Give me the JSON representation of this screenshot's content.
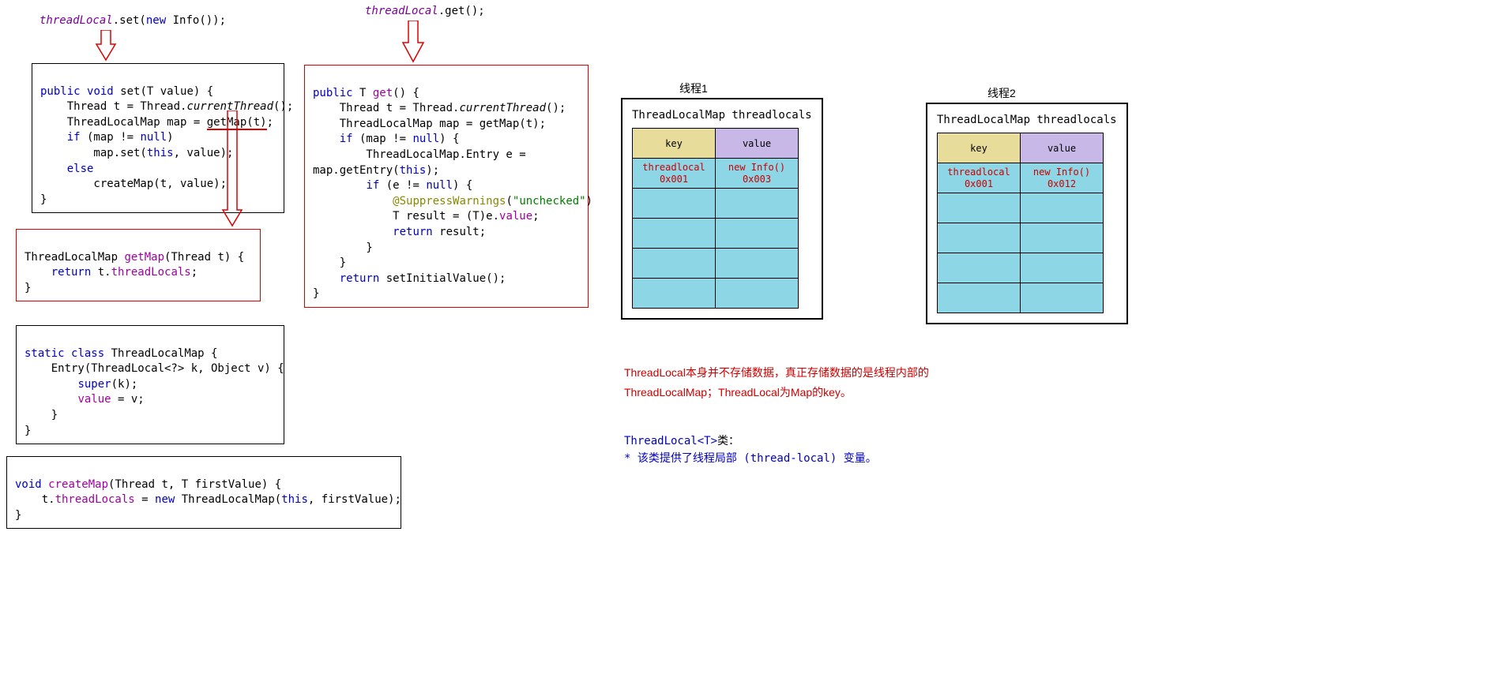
{
  "title_set": {
    "pre": "threadLocal",
    "mid": ".set(",
    "kw": "new",
    "post": " Info());"
  },
  "title_get": {
    "pre": "threadLocal",
    "post": ".get();"
  },
  "code_set": {
    "l1a": "public",
    "l1b": "void",
    "l1c": " set(T value) {",
    "l2a": "    Thread t = Thread.",
    "l2b": "currentThread",
    "l2c": "();",
    "l3a": "    ThreadLocalMap map = ",
    "l3b": "getMap(t)",
    "l3c": ";",
    "l4a": "    ",
    "l4b": "if",
    "l4c": " (map != ",
    "l4d": "null",
    "l4e": ")",
    "l5a": "        map.set(",
    "l5b": "this",
    "l5c": ", value);",
    "l6a": "    ",
    "l6b": "else",
    "l7": "        createMap(t, value);",
    "l8": "}"
  },
  "code_getmap": {
    "l1a": "ThreadLocalMap ",
    "l1b": "getMap",
    "l1c": "(Thread t) {",
    "l2a": "    ",
    "l2b": "return",
    "l2c": " t.",
    "l2d": "threadLocals",
    "l2e": ";",
    "l3": "}"
  },
  "code_tlmap": {
    "l1a": "static",
    "l1b": "class",
    "l1c": " ThreadLocalMap {",
    "l2": "    Entry(ThreadLocal<?> k, Object v) {",
    "l3a": "        ",
    "l3b": "super",
    "l3c": "(k);",
    "l4a": "        ",
    "l4b": "value",
    "l4c": " = v;",
    "l5": "    }",
    "l6": "}"
  },
  "code_create": {
    "l1a": "void",
    "l1b": " ",
    "l1c": "createMap",
    "l1d": "(Thread t, T firstValue) {",
    "l2a": "    t.",
    "l2b": "threadLocals",
    "l2c": " = ",
    "l2d": "new",
    "l2e": " ThreadLocalMap(",
    "l2f": "this",
    "l2g": ", firstValue);",
    "l3": "}"
  },
  "code_get": {
    "l1a": "public",
    "l1b": " T ",
    "l1c": "get",
    "l1d": "() {",
    "l2a": "    Thread t = Thread.",
    "l2b": "currentThread",
    "l2c": "();",
    "l3": "    ThreadLocalMap map = getMap(t);",
    "l4a": "    ",
    "l4b": "if",
    "l4c": " (map != ",
    "l4d": "null",
    "l4e": ") {",
    "l5": "        ThreadLocalMap.Entry e =",
    "l5b": "map.getEntry(",
    "l5c": "this",
    "l5d": ");",
    "l6a": "        ",
    "l6b": "if",
    "l6c": " (e != ",
    "l6d": "null",
    "l6e": ") {",
    "l7a": "            ",
    "l7b": "@SuppressWarnings",
    "l7c": "(",
    "l7d": "\"unchecked\"",
    "l7e": ")",
    "l8a": "            T result = (T)e.",
    "l8b": "value",
    "l8c": ";",
    "l9a": "            ",
    "l9b": "return",
    "l9c": " result;",
    "l10": "        }",
    "l11": "    }",
    "l12a": "    ",
    "l12b": "return",
    "l12c": " setInitialValue();",
    "l13": "}"
  },
  "thread1": {
    "title": "线程1",
    "map_label": "ThreadLocalMap  threadlocals",
    "key_header": "key",
    "value_header": "value",
    "key1_a": "threadlocal",
    "key1_b": "0x001",
    "val1_a": "new Info()",
    "val1_b": "0x003"
  },
  "thread2": {
    "title": "线程2",
    "map_label": "ThreadLocalMap  threadlocals",
    "key_header": "key",
    "value_header": "value",
    "key1_a": "threadlocal",
    "key1_b": "0x001",
    "val1_a": "new Info()",
    "val1_b": "0x012"
  },
  "note_red": {
    "l1": "ThreadLocal本身并不存储数据，真正存储数据的是线程内部的",
    "l2": "ThreadLocalMap；ThreadLocal为Map的key。"
  },
  "note_blue": {
    "l1a": "ThreadLocal<T>",
    "l1b": "类：",
    "l2": "*      该类提供了线程局部 (thread-local) 变量。"
  }
}
